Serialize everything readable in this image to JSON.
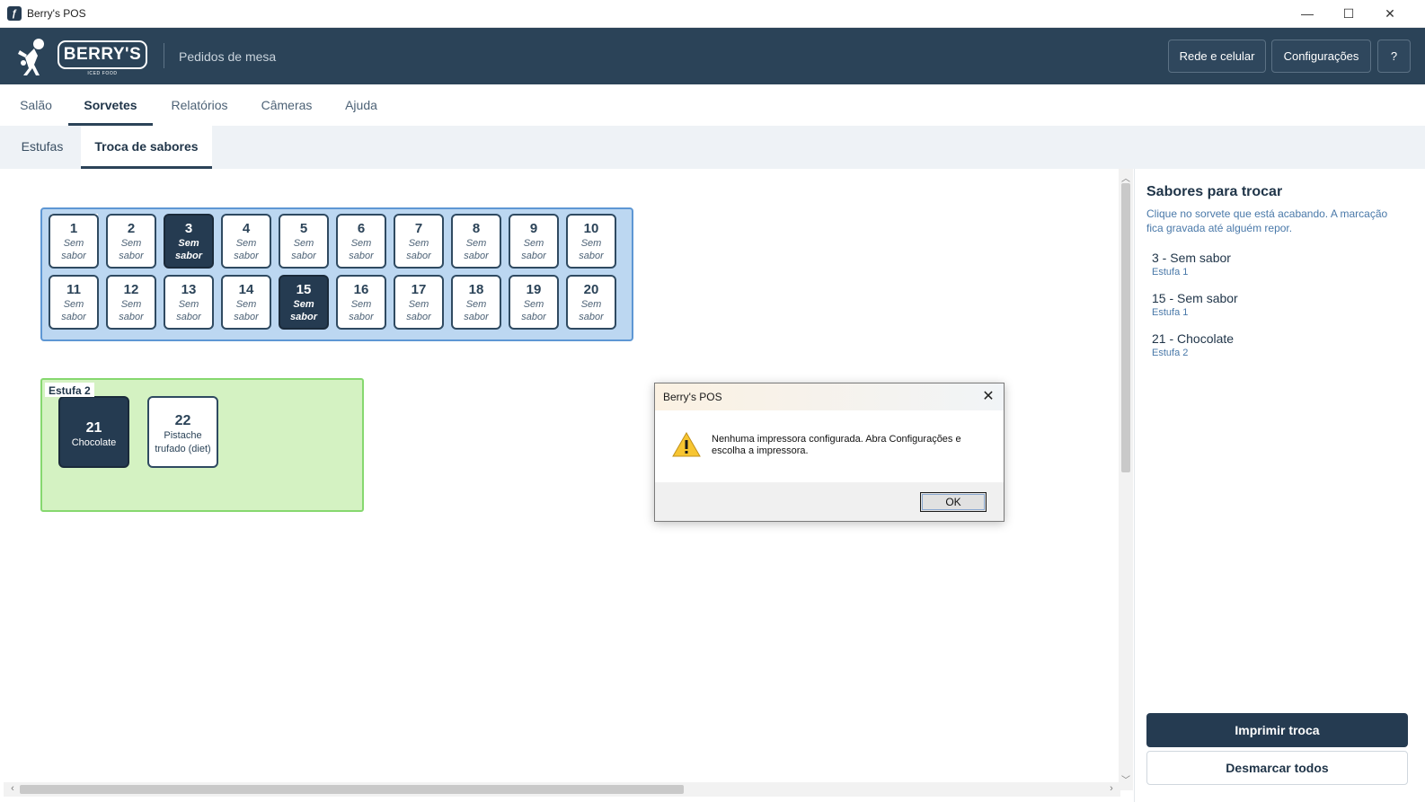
{
  "window": {
    "title": "Berry's POS",
    "minimize": "—",
    "maximize": "☐",
    "close": "✕"
  },
  "header": {
    "logo_text": "BERRY'S",
    "logo_sub": "ICED FOOD",
    "page_label": "Pedidos de mesa",
    "buttons": {
      "network": "Rede e celular",
      "settings": "Configurações",
      "help": "?"
    }
  },
  "main_tabs": [
    "Salão",
    "Sorvetes",
    "Relatórios",
    "Câmeras",
    "Ajuda"
  ],
  "main_tab_active": "Sorvetes",
  "sub_tabs": [
    "Estufas",
    "Troca de sabores"
  ],
  "sub_tab_active": "Troca de sabores",
  "estufa1": {
    "slots": [
      {
        "num": "1",
        "l1": "Sem",
        "l2": "sabor",
        "selected": false
      },
      {
        "num": "2",
        "l1": "Sem",
        "l2": "sabor",
        "selected": false
      },
      {
        "num": "3",
        "l1": "Sem",
        "l2": "sabor",
        "selected": true
      },
      {
        "num": "4",
        "l1": "Sem",
        "l2": "sabor",
        "selected": false
      },
      {
        "num": "5",
        "l1": "Sem",
        "l2": "sabor",
        "selected": false
      },
      {
        "num": "6",
        "l1": "Sem",
        "l2": "sabor",
        "selected": false
      },
      {
        "num": "7",
        "l1": "Sem",
        "l2": "sabor",
        "selected": false
      },
      {
        "num": "8",
        "l1": "Sem",
        "l2": "sabor",
        "selected": false
      },
      {
        "num": "9",
        "l1": "Sem",
        "l2": "sabor",
        "selected": false
      },
      {
        "num": "10",
        "l1": "Sem",
        "l2": "sabor",
        "selected": false
      },
      {
        "num": "11",
        "l1": "Sem",
        "l2": "sabor",
        "selected": false
      },
      {
        "num": "12",
        "l1": "Sem",
        "l2": "sabor",
        "selected": false
      },
      {
        "num": "13",
        "l1": "Sem",
        "l2": "sabor",
        "selected": false
      },
      {
        "num": "14",
        "l1": "Sem",
        "l2": "sabor",
        "selected": false
      },
      {
        "num": "15",
        "l1": "Sem",
        "l2": "sabor",
        "selected": true
      },
      {
        "num": "16",
        "l1": "Sem",
        "l2": "sabor",
        "selected": false
      },
      {
        "num": "17",
        "l1": "Sem",
        "l2": "sabor",
        "selected": false
      },
      {
        "num": "18",
        "l1": "Sem",
        "l2": "sabor",
        "selected": false
      },
      {
        "num": "19",
        "l1": "Sem",
        "l2": "sabor",
        "selected": false
      },
      {
        "num": "20",
        "l1": "Sem",
        "l2": "sabor",
        "selected": false
      }
    ]
  },
  "estufa2": {
    "label": "Estufa 2",
    "slots": [
      {
        "num": "21",
        "l1": "Chocolate",
        "l2": "",
        "selected": true
      },
      {
        "num": "22",
        "l1": "Pistache",
        "l2": "trufado (diet)",
        "selected": false
      }
    ]
  },
  "panel": {
    "title": "Sabores para trocar",
    "description": "Clique no sorvete que está acabando. A marcação fica gravada até alguém repor.",
    "items": [
      {
        "name": "3 - Sem sabor",
        "place": "Estufa 1"
      },
      {
        "name": "15 - Sem sabor",
        "place": "Estufa 1"
      },
      {
        "name": "21 - Chocolate",
        "place": "Estufa 2"
      }
    ],
    "print_label": "Imprimir troca",
    "clear_label": "Desmarcar todos"
  },
  "dialog": {
    "title": "Berry's POS",
    "message": "Nenhuma impressora configurada. Abra Configurações e escolha a impressora.",
    "ok_label": "OK"
  },
  "scroll": {
    "up": "︿",
    "down": "﹀",
    "left": "‹",
    "right": "›"
  },
  "colors": {
    "brand_dark": "#2b4358",
    "estufa1_bg": "#bcd7f1",
    "estufa2_bg": "#d4f2c2",
    "selected": "#253b51"
  }
}
